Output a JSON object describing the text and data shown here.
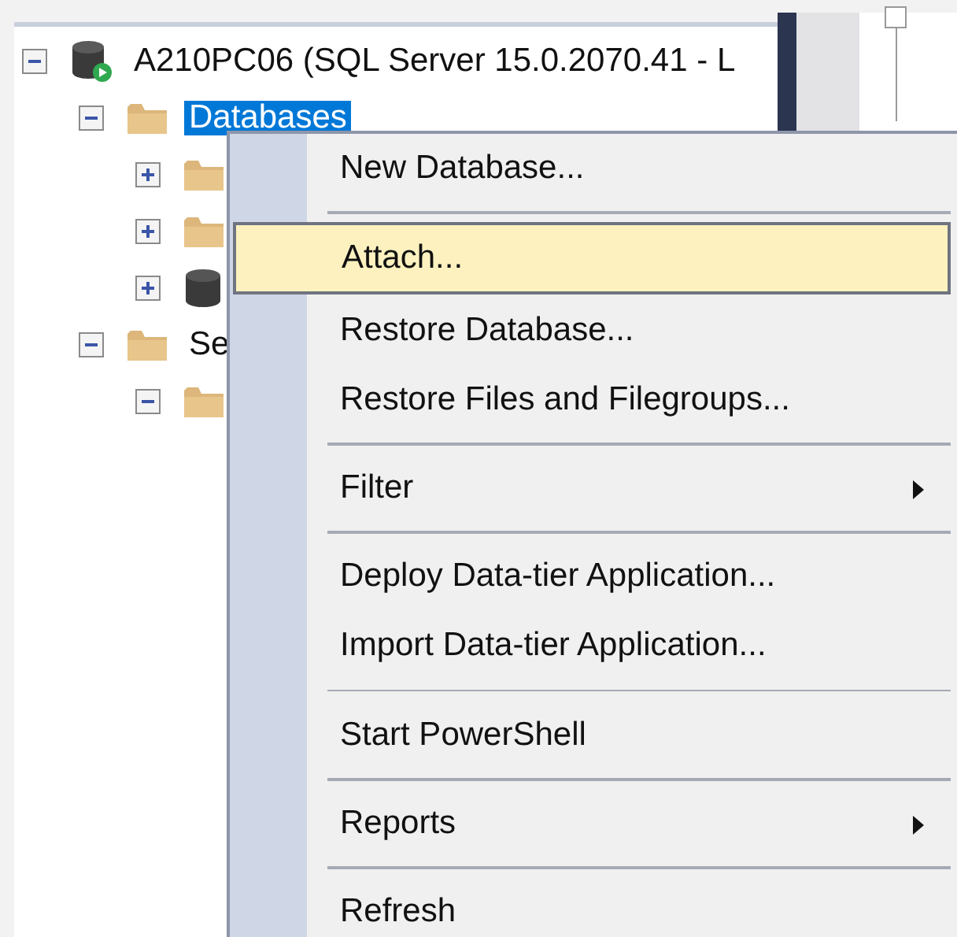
{
  "tree": [
    {
      "label": "A210PC06 (SQL Server 15.0.2070.41 - L",
      "kind": "server",
      "expanded": true,
      "selected": false,
      "children": [
        {
          "label": "Databases",
          "kind": "folder",
          "expanded": true,
          "selected": true,
          "children": [
            {
              "kind": "folder",
              "expanded": false
            },
            {
              "kind": "folder",
              "expanded": false
            },
            {
              "kind": "database",
              "expanded": false
            }
          ]
        },
        {
          "label": "Se",
          "kind": "folder",
          "expanded": true,
          "selected": false,
          "children": [
            {
              "kind": "folder",
              "expanded": true
            }
          ]
        }
      ]
    }
  ],
  "right_pane": {
    "checkbox": {
      "checked": false
    }
  },
  "context_menu": [
    {
      "kind": "item",
      "label": "New Database...",
      "selected": false,
      "submenu": false
    },
    {
      "kind": "separator"
    },
    {
      "kind": "item",
      "label": "Attach...",
      "selected": true,
      "submenu": false
    },
    {
      "kind": "item",
      "label": "Restore Database...",
      "selected": false,
      "submenu": false
    },
    {
      "kind": "item",
      "label": "Restore Files and Filegroups...",
      "selected": false,
      "submenu": false
    },
    {
      "kind": "separator"
    },
    {
      "kind": "item",
      "label": "Filter",
      "selected": false,
      "submenu": true
    },
    {
      "kind": "separator"
    },
    {
      "kind": "item",
      "label": "Deploy Data-tier Application...",
      "selected": false,
      "submenu": false
    },
    {
      "kind": "item",
      "label": "Import Data-tier Application...",
      "selected": false,
      "submenu": false
    },
    {
      "kind": "separator"
    },
    {
      "kind": "item",
      "label": "Start PowerShell",
      "selected": false,
      "submenu": false
    },
    {
      "kind": "separator"
    },
    {
      "kind": "item",
      "label": "Reports",
      "selected": false,
      "submenu": true
    },
    {
      "kind": "separator"
    },
    {
      "kind": "item",
      "label": "Refresh",
      "selected": false,
      "submenu": false
    }
  ]
}
